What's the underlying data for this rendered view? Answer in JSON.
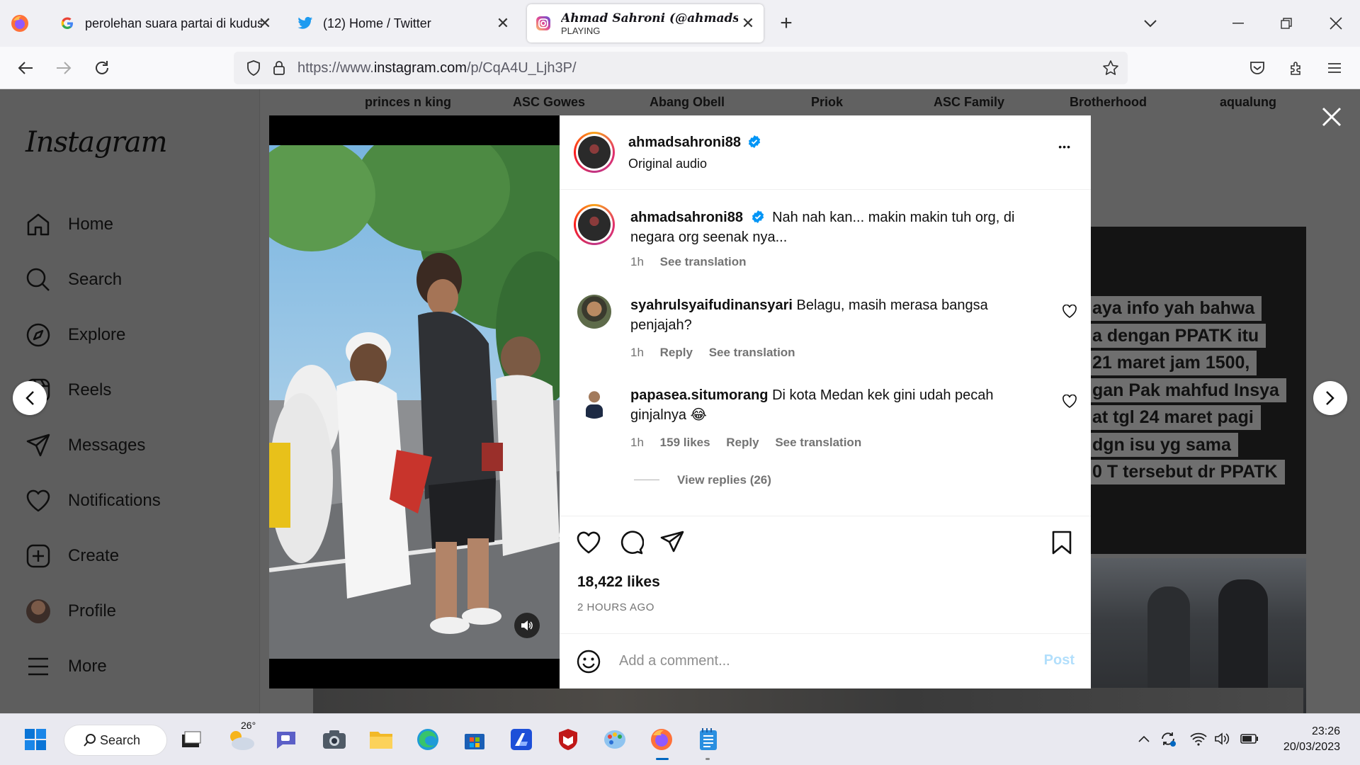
{
  "browser": {
    "tabs": [
      {
        "label": "perolehan suara partai di kudus",
        "close": "✕"
      },
      {
        "label": "(12) Home / Twitter",
        "close": "✕"
      },
      {
        "label": "Ahmad Sahroni (@ahmadsah",
        "sublabel": "PLAYING",
        "close": "✕"
      }
    ],
    "new_tab": "+",
    "url_prefix": "https://www.",
    "url_domain": "instagram.com",
    "url_path": "/p/CqA4U_Ljh3P/"
  },
  "instagram": {
    "logo": "Instagram",
    "sidebar": [
      {
        "label": "Home",
        "icon": "home-icon"
      },
      {
        "label": "Search",
        "icon": "search-icon"
      },
      {
        "label": "Explore",
        "icon": "explore-icon"
      },
      {
        "label": "Reels",
        "icon": "reels-icon"
      },
      {
        "label": "Messages",
        "icon": "messages-icon"
      },
      {
        "label": "Notifications",
        "icon": "heart-icon"
      },
      {
        "label": "Create",
        "icon": "create-icon"
      },
      {
        "label": "Profile",
        "icon": "avatar"
      },
      {
        "label": "More",
        "icon": "menu-icon"
      }
    ],
    "stories": [
      "princes n king",
      "ASC Gowes",
      "Abang Obell",
      "Priok",
      "ASC Family",
      "Brotherhood",
      "aqualung"
    ],
    "bg_caption_lines": [
      "aya info yah bahwa",
      "a dengan PPATK itu",
      "21 maret jam 1500,",
      "gan Pak mahfud Insya",
      "at tgl 24 maret pagi",
      "dgn isu yg sama",
      "0 T tersebut dr PPATK"
    ]
  },
  "post": {
    "author": "ahmadsahroni88",
    "audio": "Original audio",
    "more": "•••",
    "caption": {
      "user": "ahmadsahroni88",
      "text": "Nah nah kan... makin makin tuh org, di negara org seenak nya...",
      "time": "1h",
      "translate": "See translation"
    },
    "comments": [
      {
        "user": "syahrulsyaifudinansyari",
        "text": "Belagu, masih merasa bangsa penjajah?",
        "time": "1h",
        "likes": "",
        "reply": "Reply",
        "translate": "See translation"
      },
      {
        "user": "papasea.situmorang",
        "text": "Di kota Medan kek gini udah pecah ginjalnya 😂",
        "time": "1h",
        "likes": "159 likes",
        "reply": "Reply",
        "translate": "See translation"
      }
    ],
    "view_replies": "View replies (26)",
    "likes": "18,422 likes",
    "time_ago": "2 HOURS AGO",
    "comment_placeholder": "Add a comment...",
    "post_button": "Post"
  },
  "taskbar": {
    "search_label": "Search",
    "weather": "26°",
    "time": "23:26",
    "date": "20/03/2023"
  },
  "colors": {
    "instagram_blue": "#0095f6",
    "post_disabled": "#b2dffc",
    "verified": "#0095f6"
  }
}
